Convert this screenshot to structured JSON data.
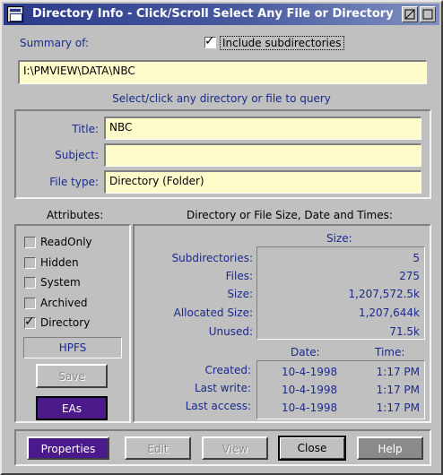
{
  "window": {
    "title": "Directory Info - Click/Scroll Select Any File or Directory"
  },
  "summary": {
    "label": "Summary of:",
    "include_subdirs_label": "Include subdirectories",
    "include_subdirs_checked": true,
    "path": "I:\\PMVIEW\\DATA\\NBC"
  },
  "prompt": "Select/click any directory or file to query",
  "details": {
    "title_label": "Title:",
    "title_value": "NBC",
    "subject_label": "Subject:",
    "subject_value": "",
    "filetype_label": "File type:",
    "filetype_value": "Directory (Folder)"
  },
  "attributes": {
    "header": "Attributes:",
    "items": [
      {
        "label": "ReadOnly",
        "checked": false
      },
      {
        "label": "Hidden",
        "checked": false
      },
      {
        "label": "System",
        "checked": false
      },
      {
        "label": "Archived",
        "checked": false
      },
      {
        "label": "Directory",
        "checked": true
      }
    ],
    "filesystem": "HPFS",
    "save_label": "Save",
    "eas_label": "EAs"
  },
  "sizes": {
    "header": "Directory or File Size, Date and Times:",
    "size_header": "Size:",
    "rows": [
      {
        "label": "Subdirectories:",
        "value": "5"
      },
      {
        "label": "Files:",
        "value": "275"
      },
      {
        "label": "Size:",
        "value": "1,207,572.5k"
      },
      {
        "label": "Allocated Size:",
        "value": "1,207,644k"
      },
      {
        "label": "Unused:",
        "value": "71.5k"
      }
    ],
    "date_header": "Date:",
    "time_header": "Time:",
    "times": [
      {
        "label": "Created:",
        "date": "10-4-1998",
        "time": "1:17 PM"
      },
      {
        "label": "Last write:",
        "date": "10-4-1998",
        "time": "1:17 PM"
      },
      {
        "label": "Last access:",
        "date": "10-4-1998",
        "time": "1:17 PM"
      }
    ]
  },
  "buttons": {
    "properties": "Properties",
    "edit": "Edit",
    "view": "View",
    "close": "Close",
    "help": "Help"
  }
}
